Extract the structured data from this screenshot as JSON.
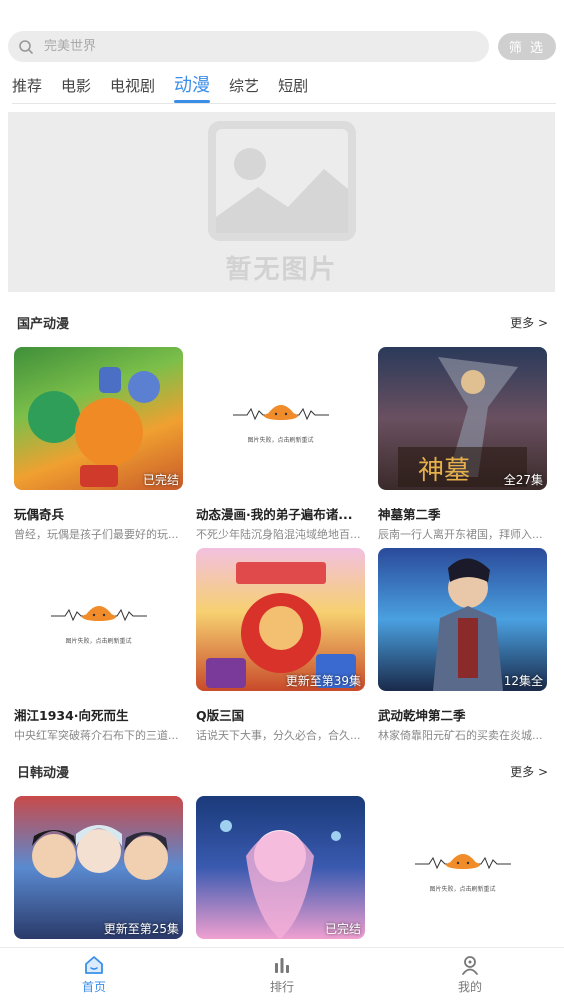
{
  "search": {
    "placeholder": "完美世界",
    "filter_label": "筛 选"
  },
  "tabs": [
    {
      "label": "推荐"
    },
    {
      "label": "电影"
    },
    {
      "label": "电视剧"
    },
    {
      "label": "动漫",
      "active": true
    },
    {
      "label": "综艺"
    },
    {
      "label": "短剧"
    }
  ],
  "banner": {
    "placeholder_text": "暂无图片"
  },
  "sections": [
    {
      "title": "国产动漫",
      "more": "更多 >",
      "items": [
        {
          "title": "玩偶奇兵",
          "desc": "曾经，玩偶是孩子们最要好的玩...",
          "badge": "已完结"
        },
        {
          "title": "动态漫画·我的弟子遍布诸...",
          "desc": "不死少年陆沉身陷混沌域绝地百...",
          "badge": "",
          "broken_image_text": "图片失败，点击刷新重试"
        },
        {
          "title": "神墓第二季",
          "desc": "辰南一行人离开东裙国，拜师入...",
          "badge": "全27集"
        },
        {
          "title": "湘江1934·向死而生",
          "desc": "中央红军突破蒋介石布下的三道...",
          "badge": "",
          "broken_image_text": "图片失败，点击刷新重试"
        },
        {
          "title": "Q版三国",
          "desc": "话说天下大事，分久必合，合久...",
          "badge": "更新至第39集"
        },
        {
          "title": "武动乾坤第二季",
          "desc": "林家倚靠阳元矿石的买卖在炎城...",
          "badge": "12集全"
        }
      ]
    },
    {
      "title": "日韩动漫",
      "more": "更多 >",
      "items": [
        {
          "title": "",
          "desc": "",
          "badge": "更新至第25集"
        },
        {
          "title": "",
          "desc": "",
          "badge": "已完结"
        },
        {
          "title": "",
          "desc": "",
          "badge": "",
          "broken_image_text": "图片失败，点击刷新重试"
        }
      ]
    }
  ],
  "bottom_nav": [
    {
      "label": "首页",
      "icon": "home-icon",
      "active": true
    },
    {
      "label": "排行",
      "icon": "rank-icon"
    },
    {
      "label": "我的",
      "icon": "profile-icon"
    }
  ],
  "colors": {
    "accent": "#3b8ee8"
  }
}
